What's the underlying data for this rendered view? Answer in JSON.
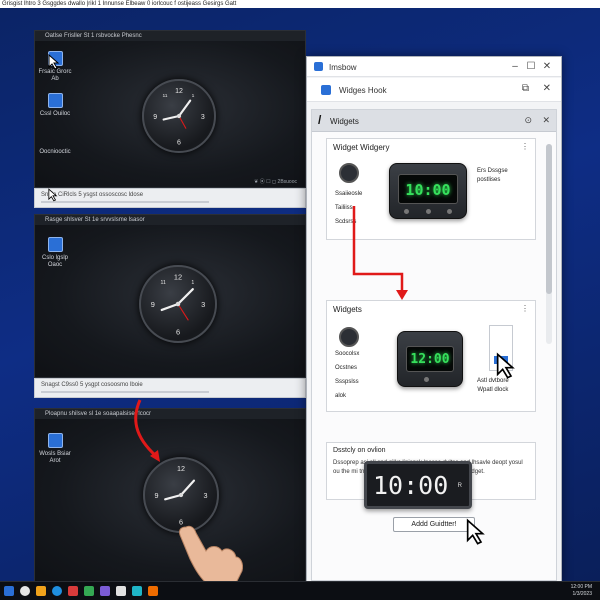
{
  "top_caption": "Grisgist lhtro 3 Gsggdes dwallo |rikl 1 Innunse Elbeaw 0 iorlcouc f ostijeass Gesirgs Gatt",
  "left_panels": {
    "panel1_title": "Oatlse Frisller St 1 rsbvocke Phesnc",
    "panel2_title": "Rasge shlsver St 1e srvvslsme lsasor",
    "panel3_title": "Ploapnu shilsve sl 1e soaapalsise rlcocr",
    "strip1_text": "Snole CiRlcls 5 ysgst ossoscosc ldose",
    "strip2_text": "Snagst C9ss0 5 ysgpt cosoosmo lboie",
    "icons": [
      "Frsaic Grorc Ab",
      "Cssl Ouiloc",
      "Oocniooctic",
      "Cslo lgslp Oaoc",
      "Wosls Bsiar Arot"
    ],
    "tray_text": "❦ ⦿ ☐ ◻ 2Bsuooc"
  },
  "win": {
    "title": "Imsbow",
    "hook_title": "Widges Hook",
    "pane_title": "Widgets",
    "card1": {
      "title": "Widget Widgery",
      "labels": [
        "Ssaiieosle",
        "Tailiiss",
        "Scdsrss"
      ],
      "side_text": "Ers Dssgse\npostlises",
      "clock_text": "10:00"
    },
    "card2": {
      "title": "Widgets",
      "labels": [
        "Soocolsx",
        "Ocstnes",
        "Ssspslss",
        "alok"
      ],
      "clock_text": "12:00",
      "extra_caption": "Astl dvtbore\nWpatl dlock"
    },
    "card3": {
      "title": "Dsstcly on ovlion",
      "body": "Dssoprep asi all snd gilkc linisnsk lnesse dultsc and lhsavle deopt yosul ou the mi tniet fhont the sn ssspodire les oer the wlddget."
    },
    "big_clock": "10:00",
    "big_clock_suffix": "R",
    "add_button": "Addd Guidtter!"
  },
  "taskbar": {
    "time": "12:00 PM\n1/3/2023"
  },
  "colors": {
    "accent": "#2a6fd6",
    "arrow": "#e01919",
    "led": "#36e05c"
  }
}
